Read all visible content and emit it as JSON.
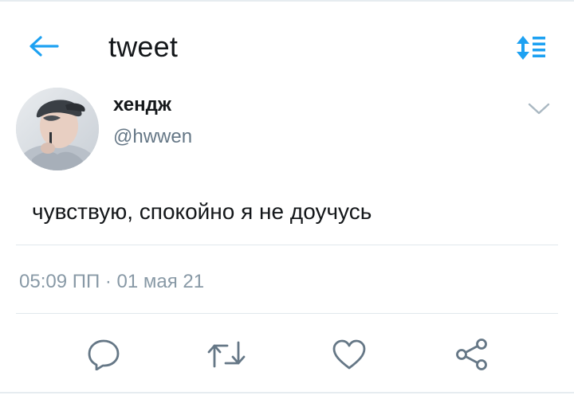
{
  "header": {
    "title": "tweet",
    "back_icon": "arrow-left-icon",
    "sort_icon": "sort-list-icon",
    "accent": "#1da1f2"
  },
  "author": {
    "name": "хендж",
    "handle": "@hwwen",
    "avatar_icon": "profile-photo",
    "more_icon": "chevron-down-icon"
  },
  "tweet": {
    "text": "чувствую, спокойно я не доучусь",
    "timestamp": "05:09 ПП · 01 мая 21"
  },
  "actions": [
    {
      "icon": "reply-icon"
    },
    {
      "icon": "retweet-icon"
    },
    {
      "icon": "like-icon"
    },
    {
      "icon": "share-icon"
    }
  ],
  "colors": {
    "text_primary": "#14171a",
    "text_secondary": "#657786",
    "timestamp": "#8899a6",
    "icon": "#657786",
    "divider": "#e1e8ed"
  }
}
